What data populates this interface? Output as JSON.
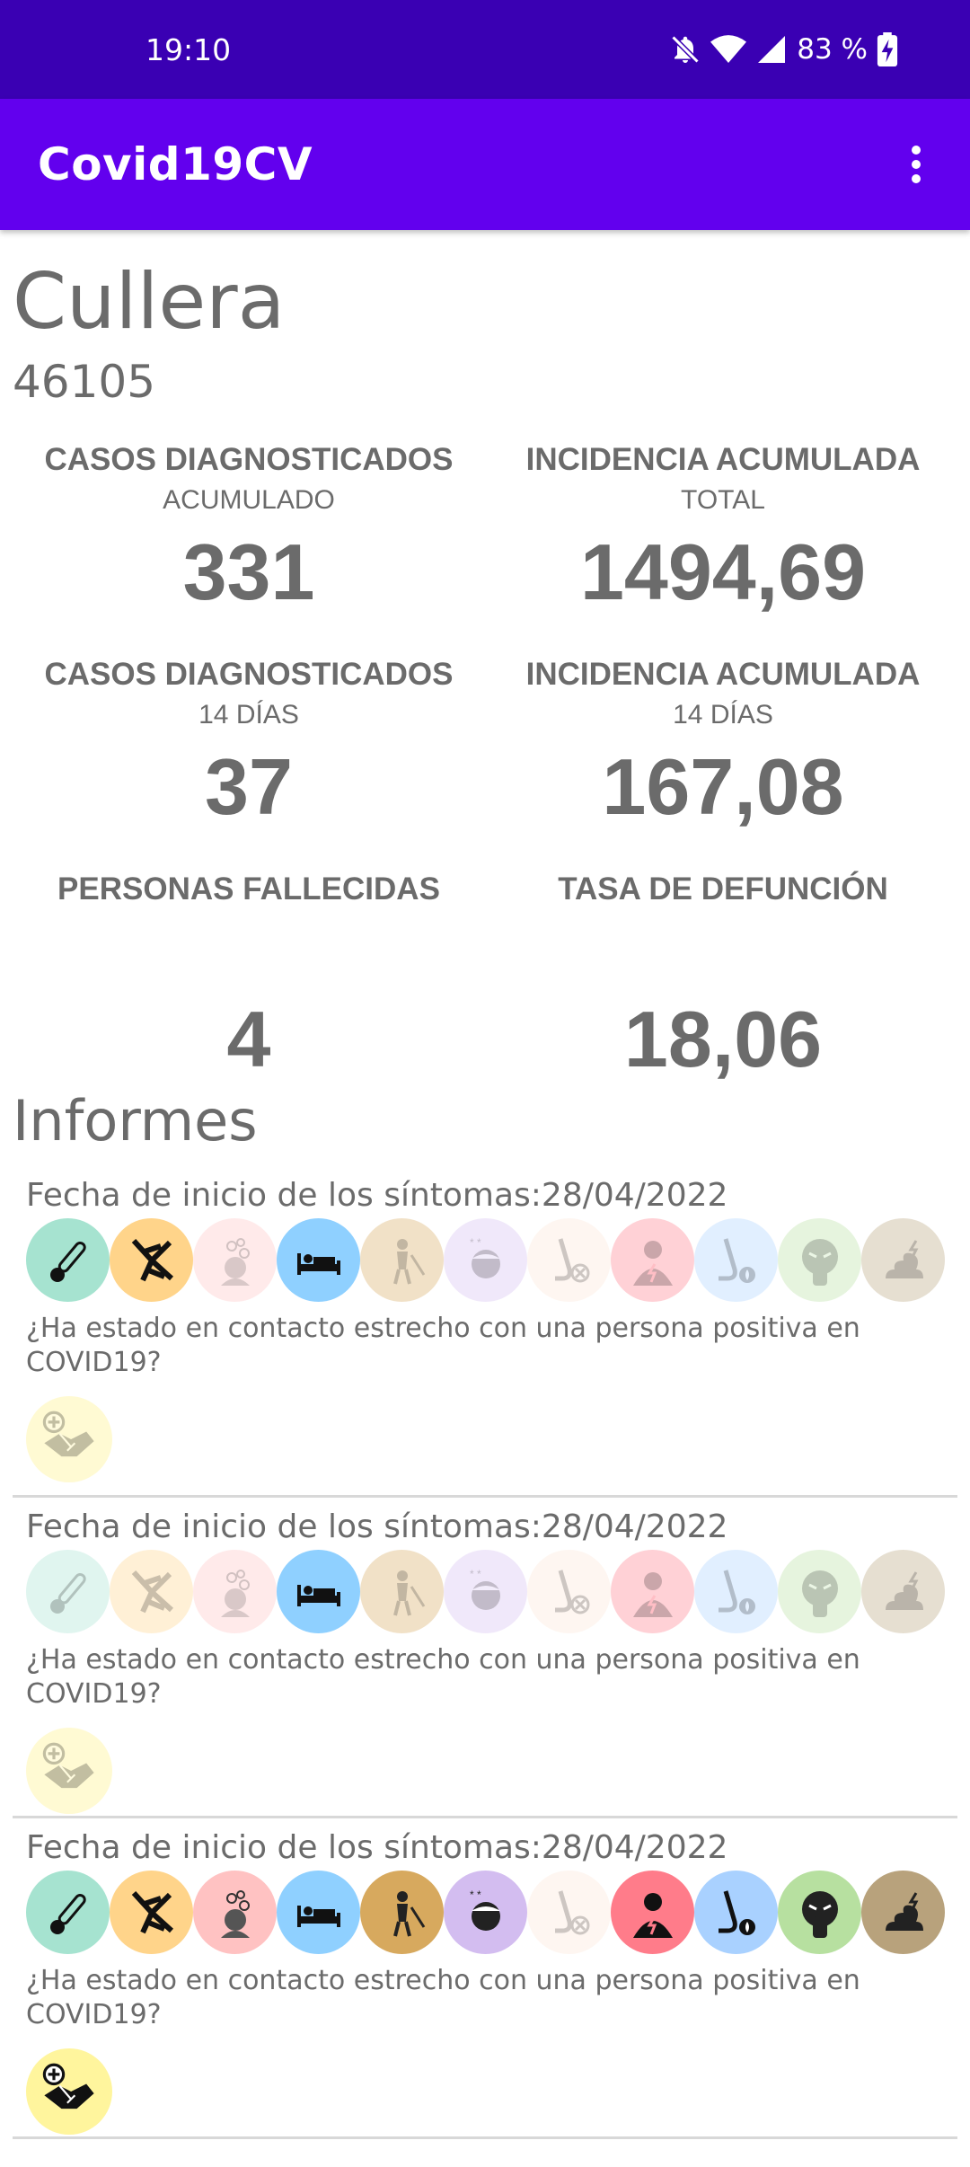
{
  "status_bar": {
    "time": "19:10",
    "battery": "83 %"
  },
  "app_bar": {
    "title": "Covid19CV"
  },
  "town": {
    "name": "Cullera",
    "postal_code": "46105"
  },
  "stats": [
    {
      "label": "CASOS DIAGNOSTICADOS",
      "sub": "ACUMULADO",
      "value": "331"
    },
    {
      "label": "INCIDENCIA ACUMULADA",
      "sub": "TOTAL",
      "value": "1494,69"
    },
    {
      "label": "CASOS DIAGNOSTICADOS",
      "sub": "14 DÍAS",
      "value": "37"
    },
    {
      "label": "INCIDENCIA ACUMULADA",
      "sub": "14 DÍAS",
      "value": "167,08"
    },
    {
      "label": "PERSONAS FALLECIDAS",
      "sub": "",
      "value": "4"
    },
    {
      "label": "TASA DE DEFUNCIÓN",
      "sub": "",
      "value": "18,06"
    }
  ],
  "reports_section": {
    "title": "Informes"
  },
  "symptom_icons": [
    {
      "name": "thermometer-icon",
      "color": "#a6e3d0"
    },
    {
      "name": "muscle-pain-icon",
      "color": "#ffd48a"
    },
    {
      "name": "headache-icon",
      "color": "#ffc2c2"
    },
    {
      "name": "fatigue-bed-icon",
      "color": "#8fd0ff"
    },
    {
      "name": "chills-icon",
      "color": "#d7a95e"
    },
    {
      "name": "dizziness-icon",
      "color": "#d3bdf0"
    },
    {
      "name": "loss-of-smell-icon",
      "color": "#fbe4d6"
    },
    {
      "name": "chest-pain-icon",
      "color": "#ff7c8a"
    },
    {
      "name": "runny-nose-icon",
      "color": "#a9d1ff"
    },
    {
      "name": "vomiting-icon",
      "color": "#b7e0a0"
    },
    {
      "name": "diarrhea-icon",
      "color": "#b8a27c"
    }
  ],
  "reports": [
    {
      "date_text": "Fecha de inicio de los síntomas:28/04/2022",
      "question": "¿Ha estado en contacto estrecho con una persona positiva en COVID19?",
      "active_symptoms": [
        true,
        true,
        false,
        true,
        false,
        false,
        false,
        false,
        false,
        false,
        false
      ],
      "contact_positive": false
    },
    {
      "date_text": "Fecha de inicio de los síntomas:28/04/2022",
      "question": "¿Ha estado en contacto estrecho con una persona positiva en COVID19?",
      "active_symptoms": [
        false,
        false,
        false,
        true,
        false,
        false,
        false,
        false,
        false,
        false,
        false
      ],
      "contact_positive": false
    },
    {
      "date_text": "Fecha de inicio de los síntomas:28/04/2022",
      "question": "¿Ha estado en contacto estrecho con una persona positiva en COVID19?",
      "active_symptoms": [
        true,
        true,
        true,
        true,
        true,
        true,
        false,
        true,
        true,
        true,
        true
      ],
      "contact_positive": true
    }
  ],
  "contact_color": "#fff59d"
}
